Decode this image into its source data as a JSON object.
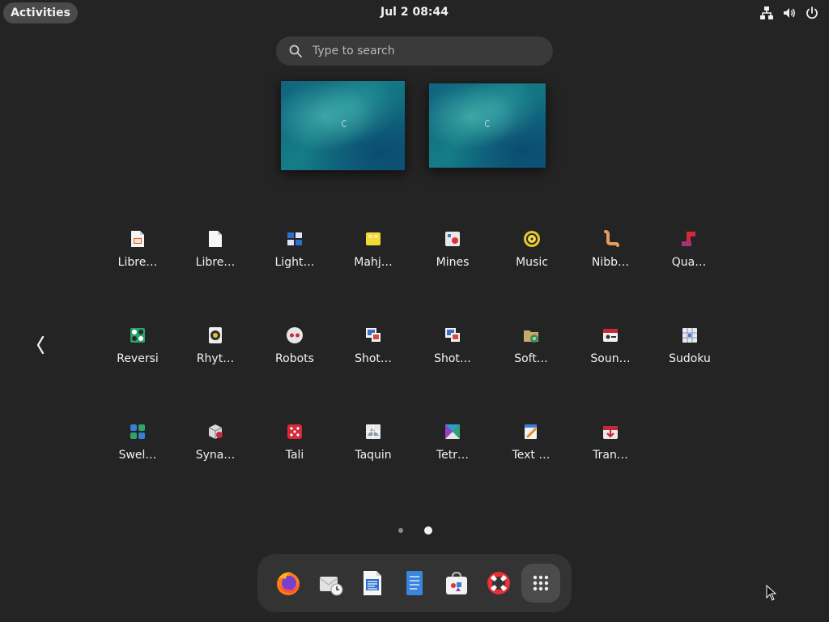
{
  "topbar": {
    "activities_label": "Activities",
    "clock": "Jul 2  08:44",
    "icons": [
      "network-icon",
      "volume-icon",
      "power-icon"
    ]
  },
  "search": {
    "placeholder": "Type to search"
  },
  "app_grid": {
    "rows": [
      [
        "Libre…",
        "Libre…",
        "Light…",
        "Mahj…",
        "Mines",
        "Music",
        "Nibb…",
        "Qua…"
      ],
      [
        "Reversi",
        "Rhyt…",
        "Robots",
        "Shot…",
        "Shot…",
        "Soft…",
        "Soun…",
        "Sudoku"
      ],
      [
        "Swel…",
        "Syna…",
        "Tali",
        "Taquin",
        "Tetr…",
        "Text …",
        "Tran…"
      ]
    ]
  },
  "pagination": {
    "pages": 2,
    "current": 2
  },
  "dash": {
    "items": [
      "firefox-icon",
      "evolution-icon",
      "libreoffice-writer-icon",
      "text-document-icon",
      "software-icon",
      "help-icon",
      "show-apps-icon"
    ]
  },
  "colors": {
    "background": "#242424",
    "search_bg": "#3a3a3a",
    "dash_bg": "#333333",
    "activities_bg": "#4a4a4a"
  }
}
